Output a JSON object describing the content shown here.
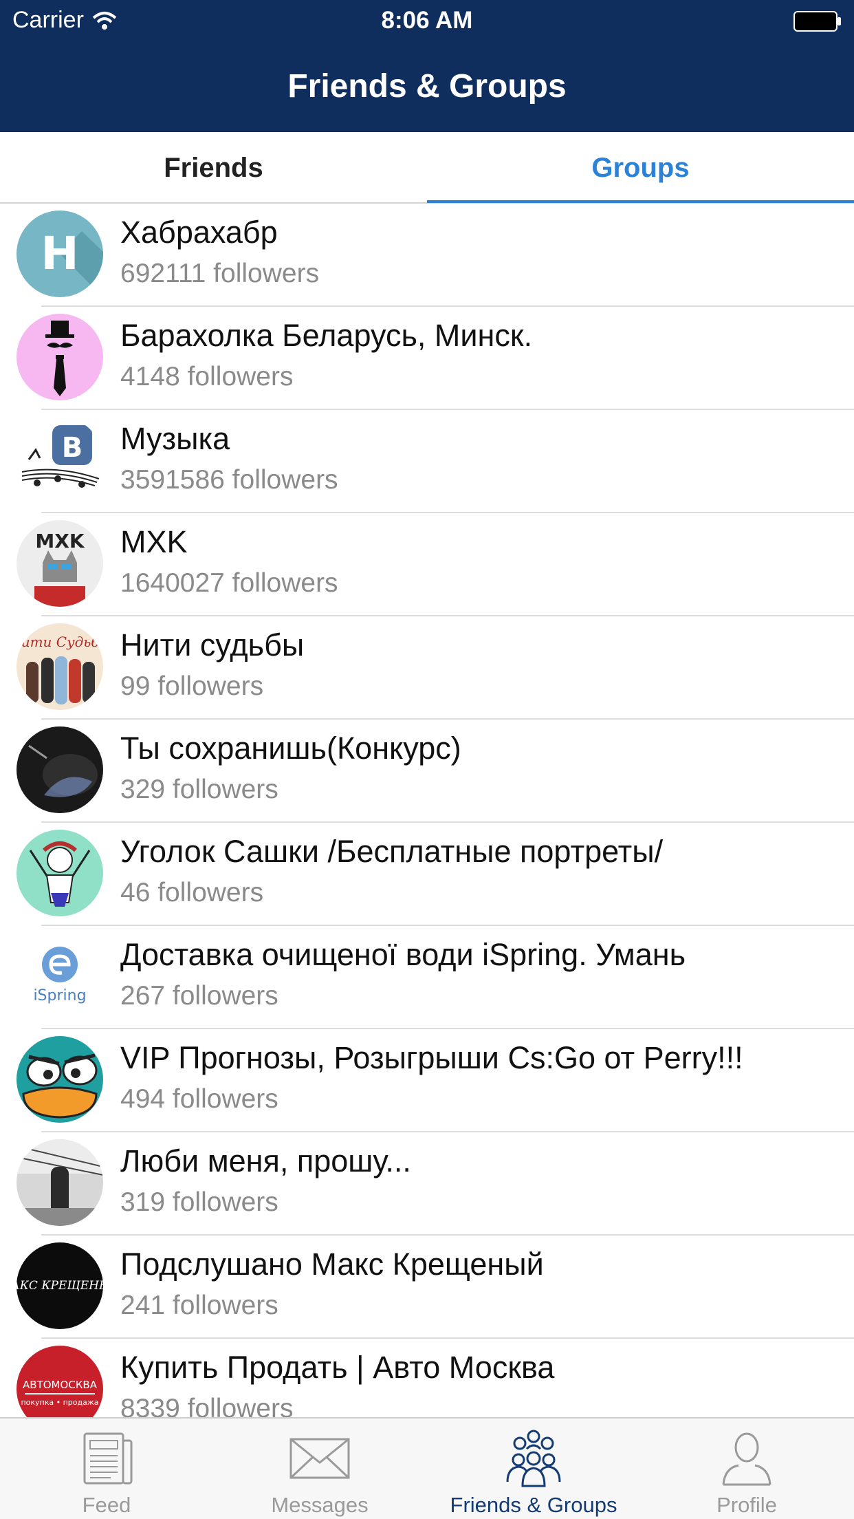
{
  "status_bar": {
    "carrier": "Carrier",
    "time": "8:06 AM"
  },
  "nav": {
    "title": "Friends & Groups"
  },
  "segments": {
    "friends": "Friends",
    "groups": "Groups",
    "selected": "Groups"
  },
  "colors": {
    "navbar": "#0f2d5d",
    "accent": "#2b82d6",
    "tab_active": "#143b73"
  },
  "groups": [
    {
      "name": "Хабрахабр",
      "followers": "692111 followers",
      "avatar": "habr-logo"
    },
    {
      "name": "Барахолка Беларусь, Минск.",
      "followers": "4148 followers",
      "avatar": "gentleman-icon"
    },
    {
      "name": "Музыка",
      "followers": "3591586 followers",
      "avatar": "vk-music-logo"
    },
    {
      "name": "MXK",
      "followers": "1640027 followers",
      "avatar": "mxk-cat-logo"
    },
    {
      "name": "Нити судьбы",
      "followers": "99 followers",
      "avatar": "photo"
    },
    {
      "name": "Ты сохранишь(Конкурс)",
      "followers": "329 followers",
      "avatar": "photo"
    },
    {
      "name": "Уголок Сашки /Бесплатные портреты/",
      "followers": "46 followers",
      "avatar": "drawing"
    },
    {
      "name": "Доставка очищеної води iSpring. Умань",
      "followers": "267 followers",
      "avatar": "ispring-logo"
    },
    {
      "name": "VIP Прогнозы, Розыгрыши Cs:Go от Perry!!!",
      "followers": "494 followers",
      "avatar": "perry-cartoon"
    },
    {
      "name": "Люби меня, прошу...",
      "followers": "319 followers",
      "avatar": "photo"
    },
    {
      "name": "Подслушано Макс Крещеный",
      "followers": "241 followers",
      "avatar": "maks-logo"
    },
    {
      "name": "Купить Продать | Авто Москва",
      "followers": "8339 followers",
      "avatar": "automoskva-logo"
    }
  ],
  "avatar_text": {
    "habr": "H",
    "vk": "B",
    "mxk": "MXK",
    "niti": "Нити Судьбы",
    "ispring": "iSpring",
    "maks": "МАКС КРЕЩЕНЫЙ",
    "avto": "АВТОМОСКВА",
    "avto_sub": "покупка • продажа"
  },
  "tabbar": [
    {
      "label": "Feed",
      "icon": "newspaper-icon",
      "active": false
    },
    {
      "label": "Messages",
      "icon": "envelope-icon",
      "active": false
    },
    {
      "label": "Friends & Groups",
      "icon": "people-icon",
      "active": true
    },
    {
      "label": "Profile",
      "icon": "person-icon",
      "active": false
    }
  ]
}
